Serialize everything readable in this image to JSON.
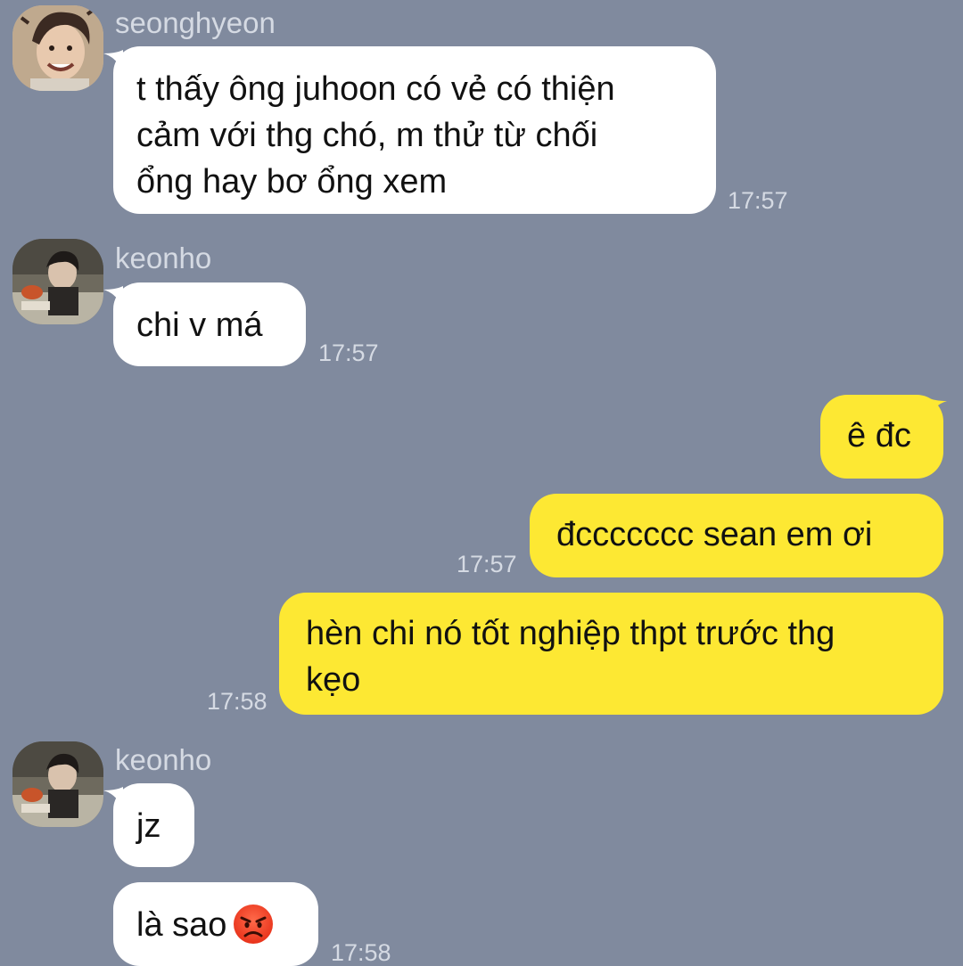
{
  "messages": [
    {
      "sender": "seonghyeon",
      "avatar": "avatar-seonghyeon",
      "lines": [
        "t thấy ông juhoon có vẻ có thiện",
        "cảm với thg chó, m thử từ chối",
        "ổng hay bơ ổng xem"
      ],
      "time": "17:57"
    },
    {
      "sender": "keonho",
      "avatar": "avatar-keonho",
      "text": "chi v má",
      "time": "17:57"
    },
    {
      "sender": "me",
      "text": "ê đc"
    },
    {
      "sender": "me",
      "text": "đccccccc sean em ơi",
      "time": "17:57"
    },
    {
      "sender": "me",
      "lines": [
        "hèn chi nó tốt nghiệp thpt trước thg",
        "kẹo"
      ],
      "time": "17:58"
    },
    {
      "sender": "keonho",
      "avatar": "avatar-keonho",
      "text": "jz"
    },
    {
      "sender": "keonho",
      "text": "là sao",
      "emoji": "angry-face-emoji",
      "time": "17:58"
    }
  ],
  "colors": {
    "background": "#808a9e",
    "incoming_bubble": "#ffffff",
    "outgoing_bubble": "#fde833",
    "meta_text": "#d5dae3"
  }
}
